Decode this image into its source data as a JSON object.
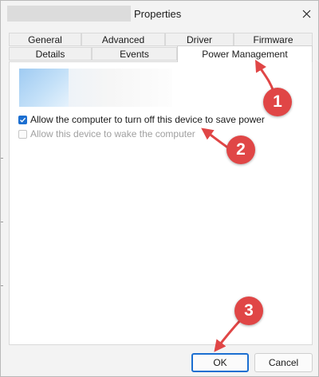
{
  "window": {
    "title": "Properties",
    "close_glyph": "✕"
  },
  "tabs": {
    "row1": [
      "General",
      "Advanced",
      "Driver",
      "Firmware"
    ],
    "row2": [
      "Details",
      "Events",
      "Power Management"
    ],
    "active": "Power Management"
  },
  "options": {
    "allow_turn_off": {
      "label": "Allow the computer to turn off this device to save power",
      "checked": true,
      "enabled": true
    },
    "allow_wake": {
      "label": "Allow this device to wake the computer",
      "checked": false,
      "enabled": false
    }
  },
  "buttons": {
    "ok": "OK",
    "cancel": "Cancel"
  },
  "annotations": [
    "1",
    "2",
    "3"
  ],
  "colors": {
    "accent": "#1c6fd1",
    "annotation": "#e04646"
  }
}
